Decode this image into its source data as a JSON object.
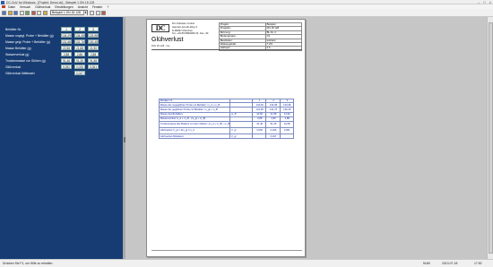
{
  "window": {
    "title": "DC-GuV for Windows - [Projekt: Demo.dc] - Beispiel 1 DN 18 128"
  },
  "menu": [
    "Datei",
    "Versuch",
    "Glühverlust",
    "Einstellungen",
    "Ansicht",
    "Fenster",
    "?"
  ],
  "toolbar": {
    "sample_select": "Beispiel 1 DN 18 128"
  },
  "left_panel": {
    "rows": [
      {
        "label": "Behälter Nr.",
        "values": [
          "1",
          "2",
          "3"
        ]
      },
      {
        "label": "Masse ungegl. Probe + Behälter (g)",
        "values": [
          "134,09",
          "134,08",
          "133,98"
        ]
      },
      {
        "label": "Masse gegl. Probe + Behälter (g)",
        "values": [
          "131,68",
          "131,76",
          "130,45"
        ]
      },
      {
        "label": "Masse Behälter (g)",
        "values": [
          "22,56",
          "21,88",
          "21,90"
        ]
      },
      {
        "label": "Wasserverlust (g)",
        "values": [
          "2,88",
          "2,86",
          "2,88"
        ]
      },
      {
        "label": "Trockenmasse vor Glühen (g)",
        "values": [
          "91,46",
          "91,35",
          "91,58"
        ]
      },
      {
        "label": "Glühverlust",
        "values": [
          "0,052",
          "0,026",
          "0,061"
        ]
      },
      {
        "label": "Glühverlust Mittelwert",
        "values": [
          "",
          "0,047",
          ""
        ]
      }
    ]
  },
  "page": {
    "company": [
      "DC-Software GmbH",
      "Hannah-Arendt-Weg 3",
      "D-80997 München",
      "Tel. +49 89 8896080 23, Fax -30"
    ],
    "project_table": [
      [
        "Projekt:",
        "Beispiel"
      ],
      [
        "Projektnr.:",
        "DN 18 128"
      ],
      [
        "Bohrung:",
        "BL-Nr. 2"
      ],
      [
        "Bodengruppe:",
        "OL"
      ],
      [
        "Bearbeiter:",
        "test/test"
      ],
      [
        "Wassergehalt:",
        "7,2%"
      ],
      [
        "Glühverl.:",
        "2,6"
      ]
    ],
    "title": "Glühverlust",
    "subtitle": "DIN 18 128 - GL",
    "results_header": [
      "Behälter Nr.",
      "",
      "1",
      "2",
      "3"
    ],
    "results_rows": [
      [
        "Masse der ungeglühten Probe mit Behälter: m_d + m_B",
        "",
        "134,09",
        "134,08",
        "133,98"
      ],
      [
        "Masse der geglühten Probe mit Behälter: m_gl + m_B",
        "",
        "131,68",
        "131,76",
        "130,45"
      ],
      [
        "Masse des Behälters",
        "m_B",
        "22,56",
        "21,88",
        "21,90"
      ],
      [
        "Massenverlust m_d + m_B - (m_gl + m_B)",
        "",
        "2,88",
        "2,86",
        "2,88"
      ],
      [
        "Trockenmasse des Bodens vor dem Glühen: (m_d + m_B) - m_B",
        "",
        "91,46",
        "91,35",
        "91,58"
      ],
      [
        "Glühverlust V_gl = Δm_gl / m_d",
        "V_gl",
        "0,052",
        "0,026",
        "0,061"
      ],
      [
        "Glühverlust Mittelwert",
        "V_gl",
        "",
        "0,047",
        ""
      ]
    ]
  },
  "status": {
    "left": "Drücken Sie F1, um Hilfe zu erhalten.",
    "mode": "NUM",
    "date": "2013-07-18",
    "time": "17:52"
  }
}
